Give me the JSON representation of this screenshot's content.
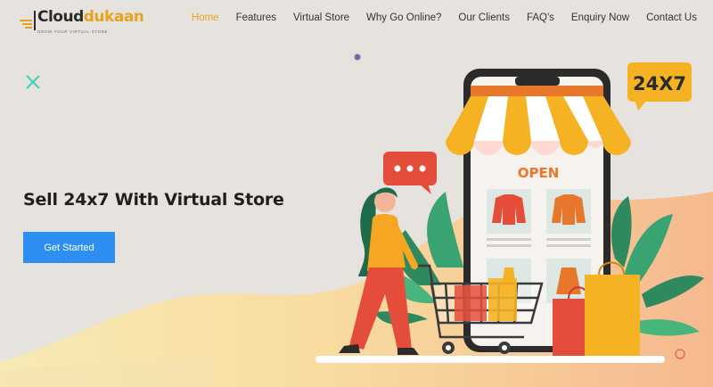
{
  "brand": {
    "logo_part1": "Cloud",
    "logo_part2": "dukaan",
    "tagline": "GROW YOUR VIRTUAL STORE"
  },
  "nav": {
    "items": [
      {
        "label": "Home",
        "active": true
      },
      {
        "label": "Features",
        "active": false
      },
      {
        "label": "Virtual Store",
        "active": false
      },
      {
        "label": "Why Go Online?",
        "active": false
      },
      {
        "label": "Our Clients",
        "active": false
      },
      {
        "label": "FAQ's",
        "active": false
      },
      {
        "label": "Enquiry Now",
        "active": false
      },
      {
        "label": "Contact Us",
        "active": false
      }
    ]
  },
  "hero": {
    "title": "Sell 24x7 With Virtual Store",
    "cta_label": "Get Started"
  },
  "illustration": {
    "open_sign": "OPEN",
    "badge": "24X7",
    "chat_dots": "•••"
  },
  "colors": {
    "accent": "#e8a21f",
    "button": "#2d8ff0",
    "background": "#e6e3df"
  }
}
